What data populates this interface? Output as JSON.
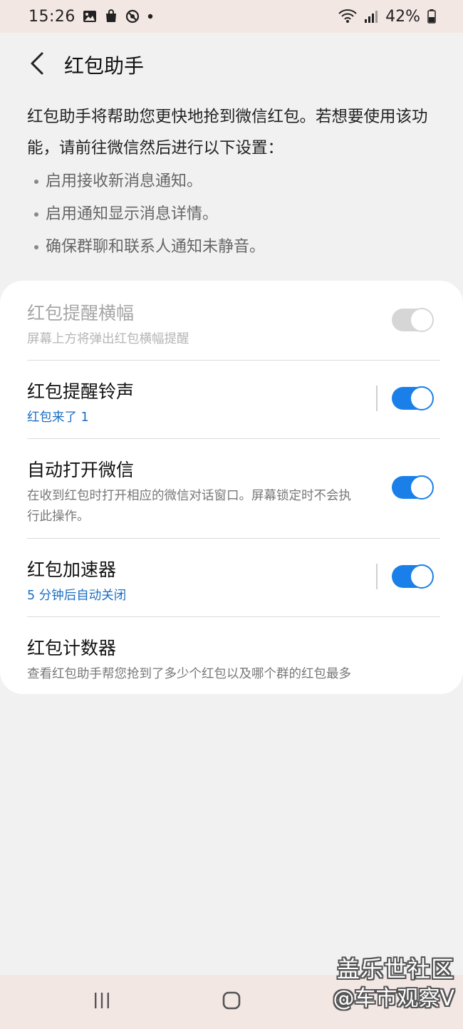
{
  "status_bar": {
    "time": "15:26",
    "icons_left": [
      "image-icon",
      "shopping-bag-icon",
      "block-icon",
      "dot-icon"
    ],
    "icons_right": [
      "wifi-icon",
      "signal-icon"
    ],
    "battery": "42%"
  },
  "header": {
    "back_icon": "chevron-left-icon",
    "title": "红包助手"
  },
  "intro": {
    "text": "红包助手将帮助您更快地抢到微信红包。若想要使用该功能，请前往微信然后进行以下设置：",
    "bullets": [
      "启用接收新消息通知。",
      "启用通知显示消息详情。",
      "确保群聊和联系人通知未静音。"
    ]
  },
  "settings": [
    {
      "title": "红包提醒横幅",
      "subtitle": "屏幕上方将弹出红包横幅提醒",
      "toggle": false,
      "enabled": false
    },
    {
      "title": "红包提醒铃声",
      "subtitle": "红包来了 1",
      "toggle": true,
      "enabled": true
    },
    {
      "title": "自动打开微信",
      "subtitle": "在收到红包时打开相应的微信对话窗口。屏幕锁定时不会执行此操作。",
      "toggle": true,
      "enabled": true
    },
    {
      "title": "红包加速器",
      "subtitle": "5 分钟后自动关闭",
      "toggle": true,
      "enabled": true
    },
    {
      "title": "红包计数器",
      "subtitle": "查看红包助手帮您抢到了多少个红包以及哪个群的红包最多",
      "enabled": true
    }
  ],
  "nav_bar": {
    "recents_icon": "recents-icon",
    "home_icon": "home-icon"
  },
  "watermark": {
    "line1": "盖乐世社区",
    "line2": "@车市观察V"
  },
  "colors": {
    "accent": "#1a7fe8",
    "link_blue": "#1a6ec2",
    "background": "#f1f1f2",
    "status_bar_bg": "#f3e7e4"
  }
}
